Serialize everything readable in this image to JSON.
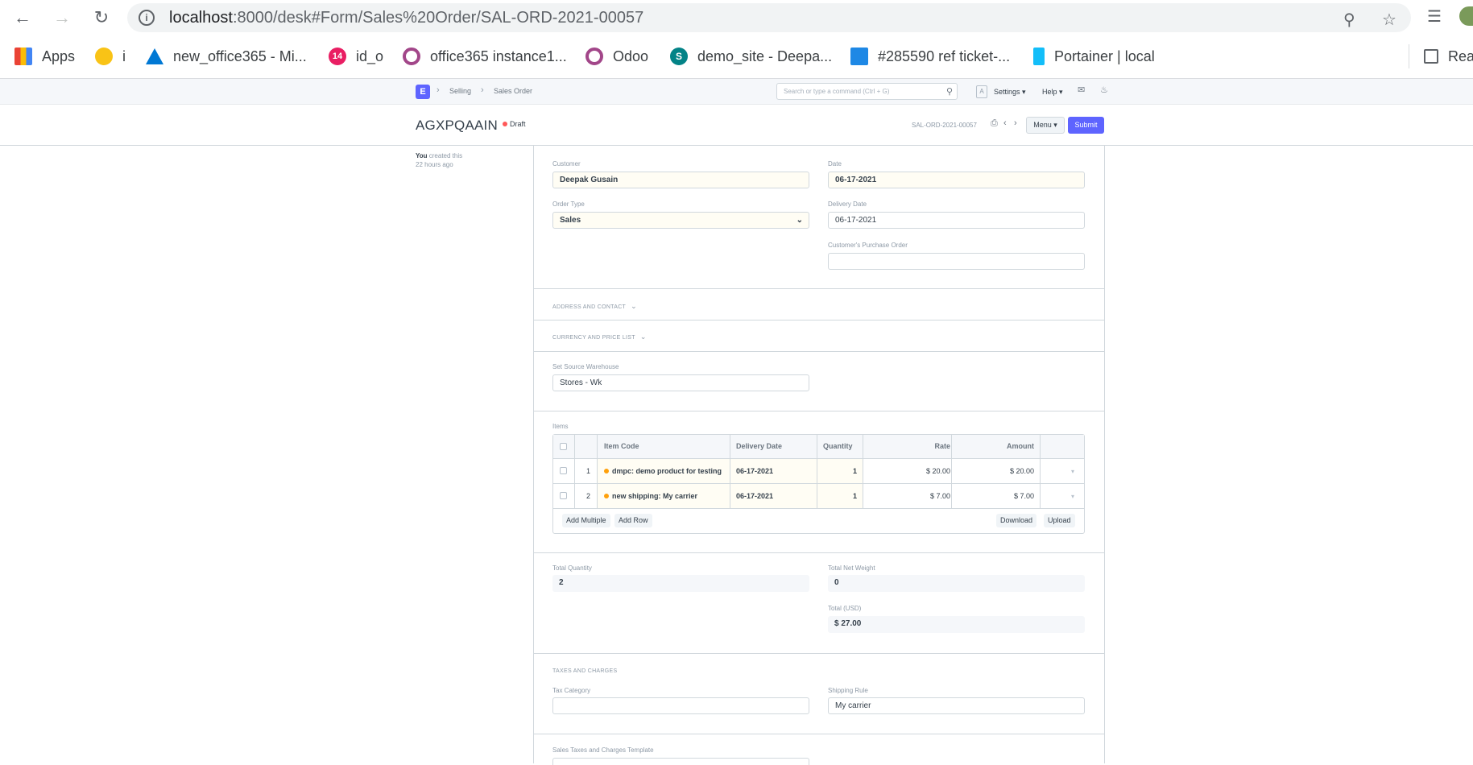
{
  "browser": {
    "url_host": "localhost",
    "url_rest": ":8000/desk#Form/Sales%20Order/SAL-ORD-2021-00057",
    "bookmarks": [
      "Apps",
      "i",
      "new_office365 - Mi...",
      "id_o",
      "office365 instance1...",
      "Odoo",
      "demo_site - Deepa...",
      "#285590 ref ticket-...",
      "Portainer | local",
      "Rea"
    ],
    "badge": "14"
  },
  "navbar": {
    "logo": "E",
    "breadcrumbs": [
      "Selling",
      "Sales Order"
    ],
    "search_placeholder": "Search or type a command (Ctrl + G)",
    "avatar": "A",
    "settings": "Settings",
    "help": "Help"
  },
  "page": {
    "title": "AGXPQAAIN",
    "status": "Draft",
    "docname": "SAL-ORD-2021-00057",
    "menu_label": "Menu",
    "submit_label": "Submit",
    "created_by": "You",
    "created_text": "created this",
    "created_when": "22 hours ago"
  },
  "form": {
    "customer_label": "Customer",
    "customer": "Deepak Gusain",
    "date_label": "Date",
    "date": "06-17-2021",
    "order_type_label": "Order Type",
    "order_type": "Sales",
    "delivery_date_label": "Delivery Date",
    "delivery_date": "06-17-2021",
    "po_label": "Customer's Purchase Order",
    "po": "",
    "section_address": "Address and Contact",
    "section_currency": "Currency and Price List",
    "warehouse_label": "Set Source Warehouse",
    "warehouse": "Stores - Wk",
    "items_label": "Items",
    "items_columns": [
      "Item Code",
      "Delivery Date",
      "Quantity",
      "Rate",
      "Amount"
    ],
    "items": [
      {
        "idx": "1",
        "item_code": "dmpc: demo product for testing",
        "delivery_date": "06-17-2021",
        "qty": "1",
        "rate": "$ 20.00",
        "amount": "$ 20.00"
      },
      {
        "idx": "2",
        "item_code": "new shipping: My carrier",
        "delivery_date": "06-17-2021",
        "qty": "1",
        "rate": "$ 7.00",
        "amount": "$ 7.00"
      }
    ],
    "add_multiple": "Add Multiple",
    "add_row": "Add Row",
    "download": "Download",
    "upload": "Upload",
    "total_qty_label": "Total Quantity",
    "total_qty": "2",
    "total_net_weight_label": "Total Net Weight",
    "total_net_weight": "0",
    "total_label": "Total (USD)",
    "total": "$ 27.00",
    "section_taxes": "Taxes and Charges",
    "tax_category_label": "Tax Category",
    "tax_category": "",
    "shipping_rule_label": "Shipping Rule",
    "shipping_rule": "My carrier",
    "taxes_template_label": "Sales Taxes and Charges Template"
  },
  "colors": {
    "primary": "#5e64ff",
    "draft_indicator": "#ff5858",
    "item_indicator": "#ffa00a",
    "mandatory_bg": "#fffdf4"
  }
}
